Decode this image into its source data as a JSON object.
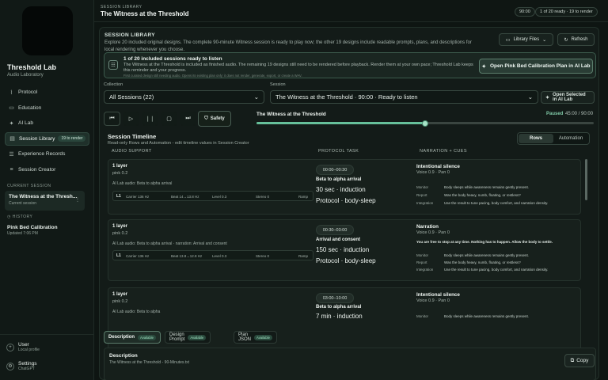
{
  "app": {
    "name": "Threshold Lab",
    "subtitle": "Audio Laboratory"
  },
  "nav": [
    {
      "label": "Protocol",
      "icon": "pulse-icon"
    },
    {
      "label": "Education",
      "icon": "book-icon"
    },
    {
      "label": "AI Lab",
      "icon": "sparkle-icon"
    },
    {
      "label": "Session Library",
      "icon": "library-icon",
      "badge": "19 to render",
      "active": true
    },
    {
      "label": "Experience Records",
      "icon": "records-icon"
    },
    {
      "label": "Session Creator",
      "icon": "sliders-icon"
    }
  ],
  "sidebar": {
    "current_label": "CURRENT SESSION",
    "current_title": "The Witness at the Thresh...",
    "current_sub": "Current session",
    "history_label": "HISTORY",
    "history_title": "Pink Bed Calibration",
    "history_sub": "Updated 7:06 PM",
    "user_title": "User",
    "user_sub": "Local profile",
    "settings_title": "Settings",
    "settings_sub": "ChatGPT"
  },
  "topbar": {
    "label": "SESSION LIBRARY",
    "title": "The Witness at the Threshold",
    "duration_chip": "90:00",
    "status_chip": "1 of 20 ready · 19 to render"
  },
  "library": {
    "label": "SESSION LIBRARY",
    "description": "Explore 20 included original designs. The complete 90-minute Witness session is ready to play now; the other 19 designs include readable prompts, plans, and descriptions for local rendering whenever you choose.",
    "files_button": "Library Files",
    "refresh_button": "Refresh"
  },
  "notice": {
    "title": "1 of 20 included sessions ready to listen",
    "body": "The Witness at the Threshold is included as finished audio. The remaining 19 designs still need to be rendered before playback. Render them at your own pace; Threshold Lab keeps this reminder and your progress.",
    "footnote": "First curated design still needing audio. Opens its existing plan only; it does not render, generate, export, or create a WAV.",
    "cta": "Open Pink Bed Calibration Plan in AI Lab"
  },
  "filters": {
    "collection_label": "Collection",
    "collection_value": "All Sessions (22)",
    "session_label": "Session",
    "session_value": "The Witness at the Threshold · 90:00 · Ready to listen",
    "open_ai_button": "Open Selected in AI Lab"
  },
  "player": {
    "safety_label": "Safety",
    "title": "The Witness at the Threshold",
    "state": "Paused",
    "time": "45:00 / 90:00",
    "progress": 0.5
  },
  "timeline": {
    "title": "Session Timeline",
    "subtitle": "Read-only Rows and Automation - edit timeline values in Session Creator",
    "toggle": [
      "Rows",
      "Automation"
    ],
    "col_audio": "AUDIO SUPPORT",
    "col_protocol": "PROTOCOL TASK",
    "col_narration": "NARRATION + CUES",
    "rows": [
      {
        "layers": "1 layer",
        "noise": "pink 0.2",
        "ai_audio": "AI Lab audio: Beta to alpha arrival",
        "layer": {
          "id": "L1",
          "carrier": "Carrier 136 Hz",
          "beat": "Beat 14→13.8 Hz",
          "level": "Level 0.3",
          "stereo": "Stereo 0",
          "ramp": "Ramp"
        },
        "time": "00:00–00:30",
        "phase": "Beta to alpha arrival",
        "duration": "30 sec · induction",
        "protocol": "Protocol · body-sleep",
        "narration": "Intentional silence",
        "voice": "Voice 0.9 · Pan 0",
        "quote": "",
        "kv": [
          {
            "k": "Monitor",
            "v": "Body sleeps while awareness remains gently present."
          },
          {
            "k": "Report",
            "v": "Was the body heavy, numb, floating, or restless?"
          },
          {
            "k": "Integration",
            "v": "Use the result to tune pacing, body comfort, and narration density."
          }
        ]
      },
      {
        "layers": "1 layer",
        "noise": "pink 0.2",
        "ai_audio": "AI Lab audio: Beta to alpha arrival · narration: Arrival and consent",
        "layer": {
          "id": "L1",
          "carrier": "Carrier 136 Hz",
          "beat": "Beat 13.8→12.8 Hz",
          "level": "Level 0.3",
          "stereo": "Stereo 0",
          "ramp": "Ramp"
        },
        "time": "00:30–03:00",
        "phase": "Arrival and consent",
        "duration": "150 sec · induction",
        "protocol": "Protocol · body-sleep",
        "narration": "Narration",
        "voice": "Voice 0.9 · Pan 0",
        "quote": "You are free to stop at any time. Nothing has to happen. Allow the body to settle.",
        "kv": [
          {
            "k": "Monitor",
            "v": "Body sleeps while awareness remains gently present."
          },
          {
            "k": "Report",
            "v": "Was the body heavy, numb, floating, or restless?"
          },
          {
            "k": "Integration",
            "v": "Use the result to tune pacing, body comfort, and narration density."
          }
        ]
      },
      {
        "layers": "1 layer",
        "noise": "pink 0.2",
        "ai_audio": "AI Lab audio: Beta to alpha",
        "time": "03:00–10:00",
        "phase": "Beta to alpha arrival",
        "duration": "7 min · induction",
        "narration": "Intentional silence",
        "voice": "Voice 0.9 · Pan 0",
        "kv": [
          {
            "k": "Monitor",
            "v": "Body sleeps while awareness remains gently present."
          }
        ]
      }
    ]
  },
  "bottom": {
    "tabs": [
      {
        "label": "Description",
        "badge": "Available"
      },
      {
        "label": "Design Prompt",
        "badge": "Available"
      },
      {
        "label": "Plan JSON",
        "badge": "Available"
      }
    ],
    "desc_title": "Description",
    "desc_file": "The Witness at the Threshold - 90-Minutes.txt",
    "copy": "Copy"
  },
  "colors": {
    "accent": "#66c09a",
    "background": "#0e1512",
    "panel": "#131b18"
  }
}
